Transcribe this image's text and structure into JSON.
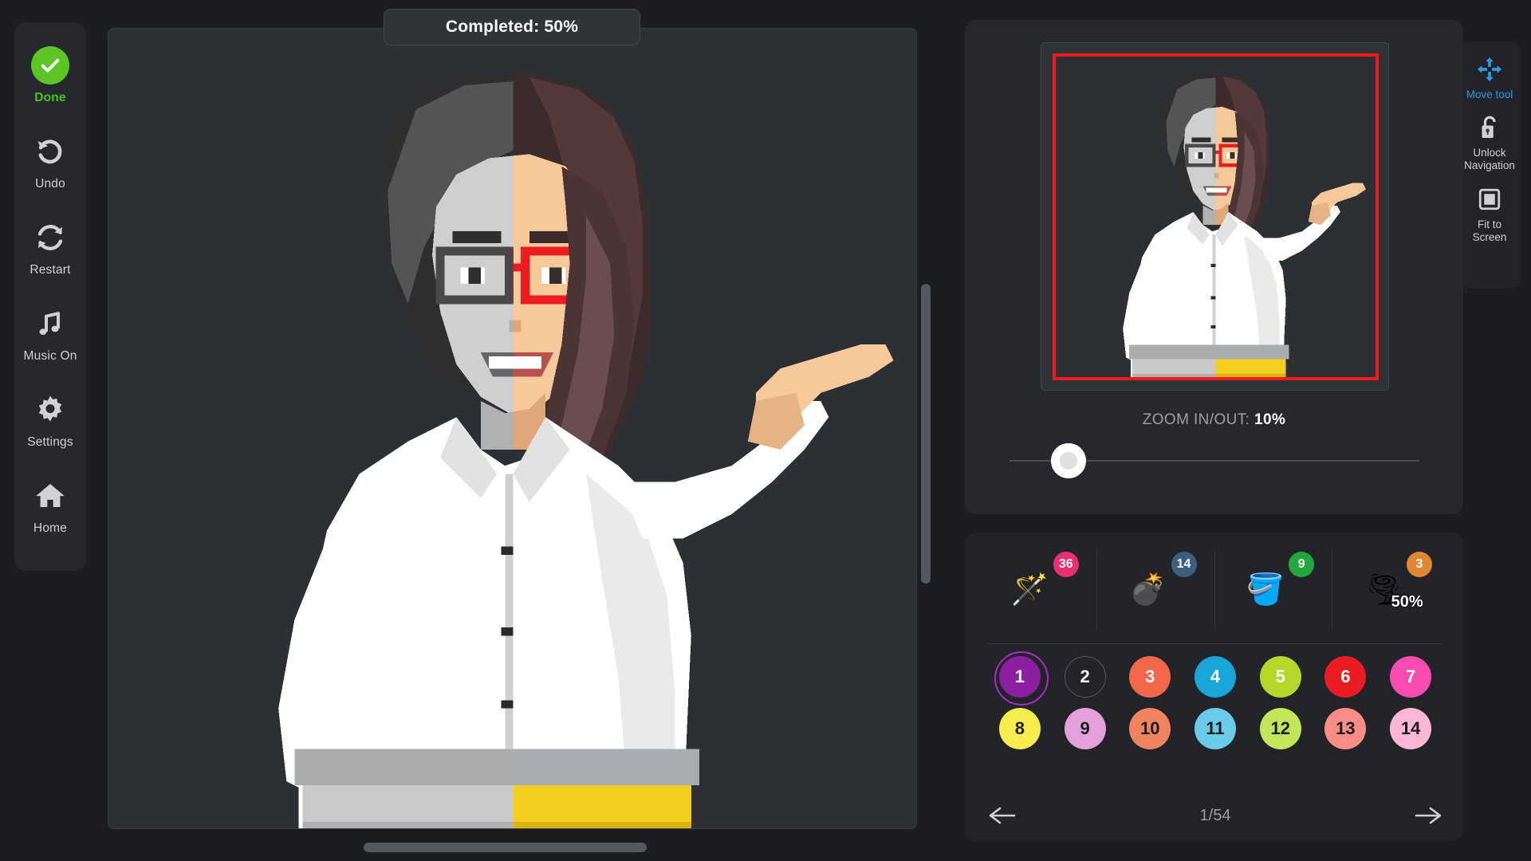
{
  "app": {
    "bg": "#1b1d21",
    "panel_bg": "#26282d",
    "panel_dark": "#222429"
  },
  "progress": {
    "label": "Completed: 50%"
  },
  "sidebar": {
    "items": [
      {
        "label": "Done",
        "icon": "check-circle-icon",
        "accent": "#4fc21d"
      },
      {
        "label": "Undo",
        "icon": "undo-arrow-icon",
        "accent": "#cfd1d4"
      },
      {
        "label": "Restart",
        "icon": "restart-icon",
        "accent": "#cfd1d4"
      },
      {
        "label": "Music On",
        "icon": "music-note-icon",
        "accent": "#cfd1d4"
      },
      {
        "label": "Settings",
        "icon": "gear-icon",
        "accent": "#cfd1d4"
      },
      {
        "label": "Home",
        "icon": "home-icon",
        "accent": "#cfd1d4"
      }
    ]
  },
  "tools": {
    "items": [
      {
        "label": "Move tool",
        "icon": "move-arrows-icon",
        "active": true,
        "color": "#2b9be3"
      },
      {
        "label": "Unlock Navigation",
        "icon": "unlock-padlock-icon",
        "active": false,
        "color": "#cfd1d4"
      },
      {
        "label": "Fit to Screen",
        "icon": "fit-to-screen-icon",
        "active": false,
        "color": "#cfd1d4"
      }
    ]
  },
  "minimap": {
    "viewport_color": "#f01c1c"
  },
  "zoom": {
    "prefix": "ZOOM IN/OUT: ",
    "value": "10%",
    "slider_percent": 10
  },
  "powerups": [
    {
      "name": "magic-wand",
      "glyph": "🪄",
      "count": "36",
      "badge_color": "#ec2f72",
      "overlay": ""
    },
    {
      "name": "bomb",
      "glyph": "💣",
      "count": "14",
      "badge_color": "#3d5f7d",
      "overlay": ""
    },
    {
      "name": "paint-bucket",
      "glyph": "🪣",
      "count": "9",
      "badge_color": "#22a83c",
      "overlay": ""
    },
    {
      "name": "tornado",
      "glyph": "🌪",
      "count": "3",
      "badge_color": "#e08734",
      "overlay": "50%"
    }
  ],
  "palette": {
    "selected": "1",
    "swatches": [
      {
        "n": "1",
        "color": "#8b1fa0",
        "text": "#ffffff",
        "state": "selected"
      },
      {
        "n": "2",
        "color": "#26282d",
        "text": "#ffffff",
        "state": "empty"
      },
      {
        "n": "3",
        "color": "#f2674a",
        "text": "#ffffff",
        "state": "normal"
      },
      {
        "n": "4",
        "color": "#19a5d8",
        "text": "#ffffff",
        "state": "normal"
      },
      {
        "n": "5",
        "color": "#b5d72c",
        "text": "#ffffff",
        "state": "normal"
      },
      {
        "n": "6",
        "color": "#ec1c24",
        "text": "#ffffff",
        "state": "normal"
      },
      {
        "n": "7",
        "color": "#f94cb2",
        "text": "#ffffff",
        "state": "normal"
      },
      {
        "n": "8",
        "color": "#f5ec4e",
        "text": "#1b1d21",
        "state": "normal"
      },
      {
        "n": "9",
        "color": "#e3a0da",
        "text": "#1b1d21",
        "state": "normal"
      },
      {
        "n": "10",
        "color": "#f08360",
        "text": "#1b1d21",
        "state": "normal"
      },
      {
        "n": "11",
        "color": "#69cbe8",
        "text": "#1b1d21",
        "state": "normal"
      },
      {
        "n": "12",
        "color": "#c3e55a",
        "text": "#1b1d21",
        "state": "normal"
      },
      {
        "n": "13",
        "color": "#fb8c86",
        "text": "#1b1d21",
        "state": "normal"
      },
      {
        "n": "14",
        "color": "#fbb6d8",
        "text": "#1b1d21",
        "state": "normal"
      }
    ]
  },
  "pager": {
    "prev_icon": "arrow-left-icon",
    "next_icon": "arrow-right-icon",
    "text": "1/54"
  },
  "artwork": {
    "title": "pixel-art-woman-pointing",
    "description": "Half-colored pixel art portrait: left half greyscale (uncolored), right half colored",
    "colors": {
      "hair_dark": "#3b2b2b",
      "hair_mid": "#6a4e4e",
      "hair_light": "#8d6f6f",
      "skin": "#f6c99a",
      "skin_shadow": "#e0a87a",
      "shirt_white": "#ffffff",
      "shirt_shade": "#e2e2e2",
      "skirt_yellow": "#f2cf1e",
      "skirt_yellow_dark": "#d8b413",
      "belt_grey": "#a9acb1",
      "glasses_red": "#ec1c24",
      "grey_0": "#ffffff",
      "grey_1": "#d9d9d9",
      "grey_2": "#b0b0b0",
      "grey_3": "#808080",
      "grey_4": "#4f4f4f",
      "grey_5": "#262626",
      "canvas_bg": "#2c2f34"
    }
  }
}
